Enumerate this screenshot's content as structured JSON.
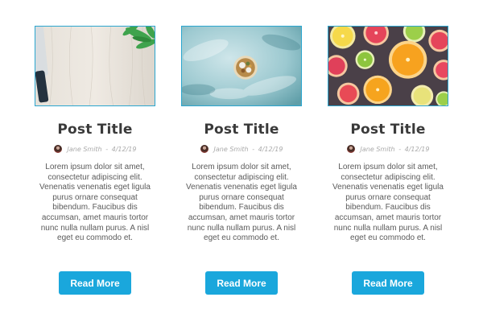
{
  "colors": {
    "accent": "#1aa7dc",
    "image_border": "#2ba6cf",
    "title": "#3a3a3a",
    "meta": "#aaaaaa",
    "body": "#5a5a5a"
  },
  "posts": [
    {
      "image": "wooden-board-with-knife-and-herbs",
      "title": "Post Title",
      "author": "Jane Smith",
      "separator": "-",
      "date": "4/12/19",
      "excerpt": "Lorem ipsum dolor sit amet, consectetur adipiscing elit. Venenatis venenatis eget ligula purus ornare consequat bibendum. Faucibus dis accumsan, amet mauris tortor nunc nulla nullam purus. A nisl eget eu commodo et.",
      "button_label": "Read More"
    },
    {
      "image": "bowl-of-food-on-blue-background",
      "title": "Post Title",
      "author": "Jane Smith",
      "separator": "-",
      "date": "4/12/19",
      "excerpt": "Lorem ipsum dolor sit amet, consectetur adipiscing elit. Venenatis venenatis eget ligula purus ornare consequat bibendum. Faucibus dis accumsan, amet mauris tortor nunc nulla nullam purus. A nisl eget eu commodo et.",
      "button_label": "Read More"
    },
    {
      "image": "sliced-citrus-fruits",
      "title": "Post Title",
      "author": "Jane Smith",
      "separator": "-",
      "date": "4/12/19",
      "excerpt": "Lorem ipsum dolor sit amet, consectetur adipiscing elit. Venenatis venenatis eget ligula purus ornare consequat bibendum. Faucibus dis accumsan, amet mauris tortor nunc nulla nullam purus. A nisl eget eu commodo et.",
      "button_label": "Read More"
    }
  ]
}
